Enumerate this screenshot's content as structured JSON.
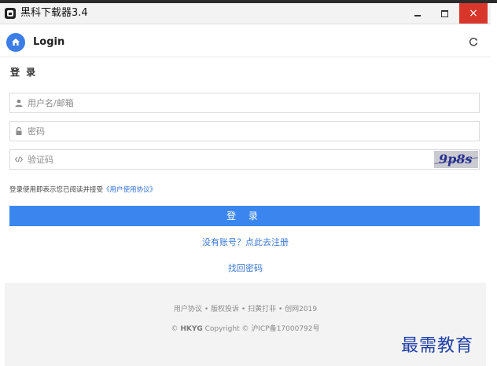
{
  "window": {
    "title": "黑科下载器3.4",
    "minimize_label": "–",
    "maximize_label": "",
    "close_label": "×"
  },
  "header": {
    "title": "Login"
  },
  "form": {
    "section_title": "登 录",
    "username_placeholder": "用户名/邮箱",
    "password_placeholder": "密码",
    "captcha_placeholder": "验证码",
    "captcha_text": "9p8s",
    "agree_text": "登录使用即表示您已阅读并接受",
    "agree_link": "《用户使用协议》",
    "submit_label": "登 录",
    "register_link": "没有账号？点此去注册",
    "recover_link": "找回密码"
  },
  "footer": {
    "links": [
      "用户协议",
      "版权投诉",
      "扫黄打非",
      "创网2019"
    ],
    "separator": "•",
    "copyright_symbol": "©",
    "brand": "HKYG",
    "copyright_text": "Copyright © 沪ICP备17000792号"
  },
  "watermark": "最需教育",
  "colors": {
    "accent": "#3b86ee",
    "link": "#3a78d8",
    "close_button": "#d9362b",
    "footer_bg": "#f3f3f3"
  },
  "icons": {
    "app": "app-icon",
    "home": "home-icon",
    "refresh": "refresh-icon",
    "user": "user-icon",
    "lock": "lock-icon",
    "code": "code-icon"
  }
}
